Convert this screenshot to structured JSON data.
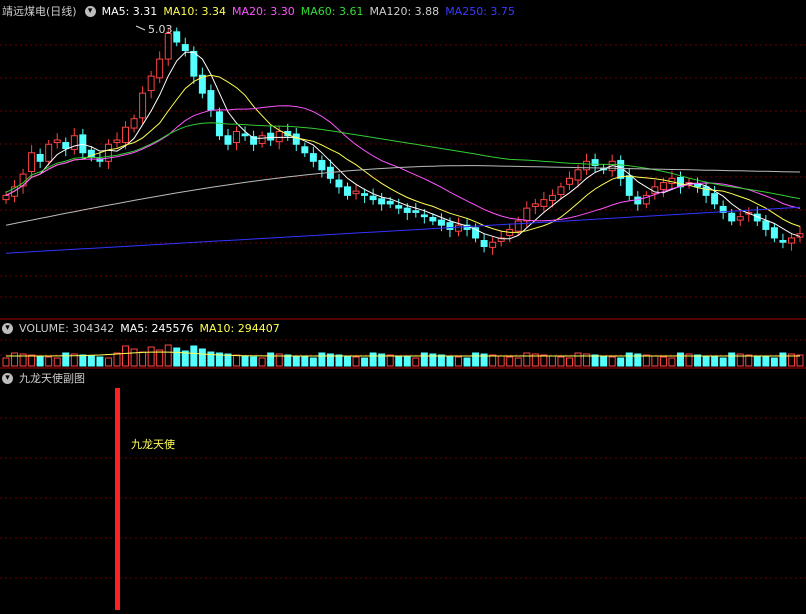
{
  "header": {
    "title": "靖远煤电(日线)",
    "ma5": "MA5: 3.31",
    "ma10": "MA10: 3.34",
    "ma20": "MA20: 3.30",
    "ma60": "MA60: 3.61",
    "ma120": "MA120: 3.88",
    "ma250": "MA250: 3.75"
  },
  "volume_header": {
    "volume": "VOLUME: 304342",
    "ma5": "MA5: 245576",
    "ma10": "MA10: 294407"
  },
  "subchart": {
    "title": "九龙天使副图",
    "label": "九龙天使"
  },
  "peak_label": "5.03",
  "colors": {
    "up": "#ff4444",
    "down": "#54ffff",
    "ma5": "#ffffff",
    "ma10": "#ffff54",
    "ma20": "#ff54ff",
    "ma60": "#33cc33",
    "ma120": "#bbbbbb",
    "ma250": "#3333ff",
    "grid": "#6e0000",
    "signal": "#ff2020"
  },
  "chart_data": {
    "type": "candlestick",
    "stock": "靖远煤电",
    "period": "日线",
    "price_peak": 5.03,
    "closes": [
      3.1,
      3.2,
      3.35,
      3.6,
      3.5,
      3.7,
      3.75,
      3.65,
      3.8,
      3.6,
      3.55,
      3.5,
      3.7,
      3.75,
      3.9,
      4.0,
      4.3,
      4.5,
      4.7,
      5.0,
      4.9,
      4.8,
      4.5,
      4.3,
      4.1,
      3.8,
      3.7,
      3.85,
      3.8,
      3.7,
      3.8,
      3.75,
      3.85,
      3.8,
      3.7,
      3.6,
      3.5,
      3.4,
      3.3,
      3.2,
      3.1,
      3.15,
      3.1,
      3.05,
      3.0,
      3.0,
      2.95,
      2.9,
      2.9,
      2.85,
      2.8,
      2.75,
      2.7,
      2.75,
      2.7,
      2.6,
      2.5,
      2.55,
      2.6,
      2.7,
      2.8,
      2.95,
      3.0,
      3.05,
      3.1,
      3.2,
      3.3,
      3.4,
      3.5,
      3.45,
      3.4,
      3.5,
      3.3,
      3.1,
      3.0,
      3.1,
      3.2,
      3.25,
      3.3,
      3.2,
      3.25,
      3.2,
      3.1,
      3.0,
      2.9,
      2.8,
      2.85,
      2.9,
      2.8,
      2.7,
      2.6,
      2.55,
      2.6,
      2.65
    ]
  }
}
